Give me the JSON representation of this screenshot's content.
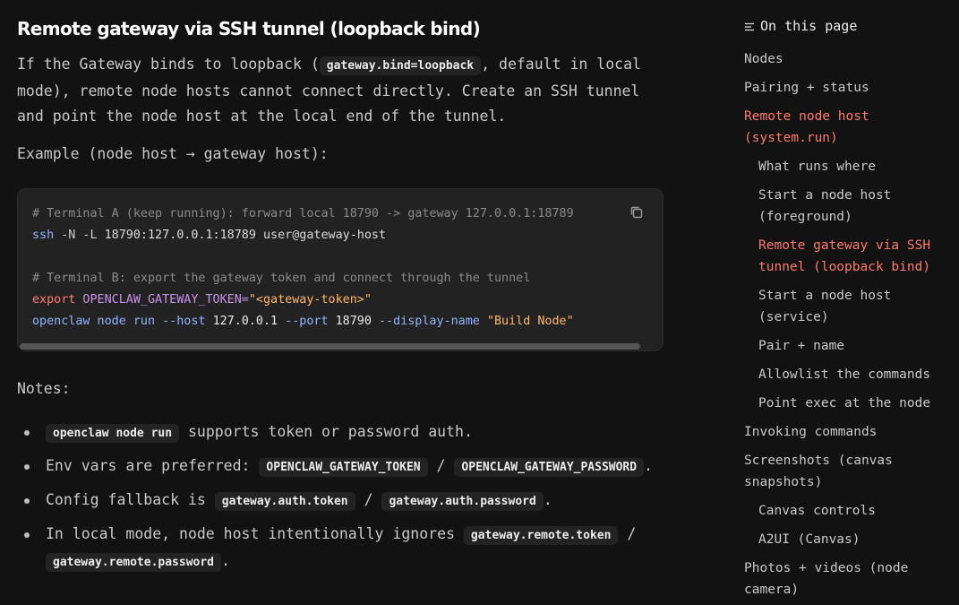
{
  "section": {
    "title": "Remote gateway via SSH tunnel (loopback bind)",
    "intro_pre": "If the Gateway binds to loopback (",
    "intro_code": "gateway.bind=loopback",
    "intro_post": ", default in local mode), remote node hosts cannot connect directly. Create an SSH tunnel and point the node host at the local end of the tunnel.",
    "example_label": "Example (node host → gateway host):"
  },
  "code_block": {
    "line1_comment": "# Terminal A (keep running): forward local 18790 -> gateway 127.0.0.1:18789",
    "line2_cmd": "ssh",
    "line2_args": " -N -L ",
    "line2_target": "18790:127.0.0.1:18789 user@gateway-host",
    "line4_comment": "# Terminal B: export the gateway token and connect through the tunnel",
    "line5_kw": "export",
    "line5_var": " OPENCLAW_GATEWAY_TOKEN=",
    "line5_str": "\"<gateway-token>\"",
    "line6_cmd": "openclaw",
    "line6_sub": " node run --host ",
    "line6_host": "127.0.0.1",
    "line6_flag": " --port ",
    "line6_port": "18790",
    "line6_flag2": " --display-name ",
    "line6_name": "\"Build Node\"",
    "copy_icon": "copy-icon"
  },
  "notes": {
    "heading": "Notes:",
    "items": [
      {
        "code1": "openclaw node run",
        "text1": " supports token or password auth."
      },
      {
        "text0": "Env vars are preferred: ",
        "code1": "OPENCLAW_GATEWAY_TOKEN",
        "text1": " / ",
        "code2": "OPENCLAW_GATEWAY_PASSWORD",
        "text2": "."
      },
      {
        "text0": "Config fallback is ",
        "code1": "gateway.auth.token",
        "text1": " / ",
        "code2": "gateway.auth.password",
        "text2": "."
      },
      {
        "text0": "In local mode, node host intentionally ignores ",
        "code1": "gateway.remote.token",
        "text1": " / ",
        "code2": "gateway.remote.password",
        "text2": "."
      }
    ]
  },
  "toc": {
    "heading": "On this page",
    "items": [
      {
        "label": "Nodes",
        "active": false
      },
      {
        "label": "Pairing + status",
        "active": false
      },
      {
        "label": "Remote node host (system.run)",
        "active": true
      },
      {
        "label": "What runs where",
        "active": false
      },
      {
        "label": "Start a node host (foreground)",
        "active": false
      },
      {
        "label": "Remote gateway via SSH tunnel (loopback bind)",
        "active": true
      },
      {
        "label": "Start a node host (service)",
        "active": false
      },
      {
        "label": "Pair + name",
        "active": false
      },
      {
        "label": "Allowlist the commands",
        "active": false
      },
      {
        "label": "Point exec at the node",
        "active": false
      },
      {
        "label": "Invoking commands",
        "active": false
      },
      {
        "label": "Screenshots (canvas snapshots)",
        "active": false
      },
      {
        "label": "Canvas controls",
        "active": false
      },
      {
        "label": "A2UI (Canvas)",
        "active": false
      },
      {
        "label": "Photos + videos (node camera)",
        "active": false
      }
    ]
  },
  "colors": {
    "background": "#121212",
    "accent": "#ff7a6e",
    "code_bg": "#222222"
  }
}
